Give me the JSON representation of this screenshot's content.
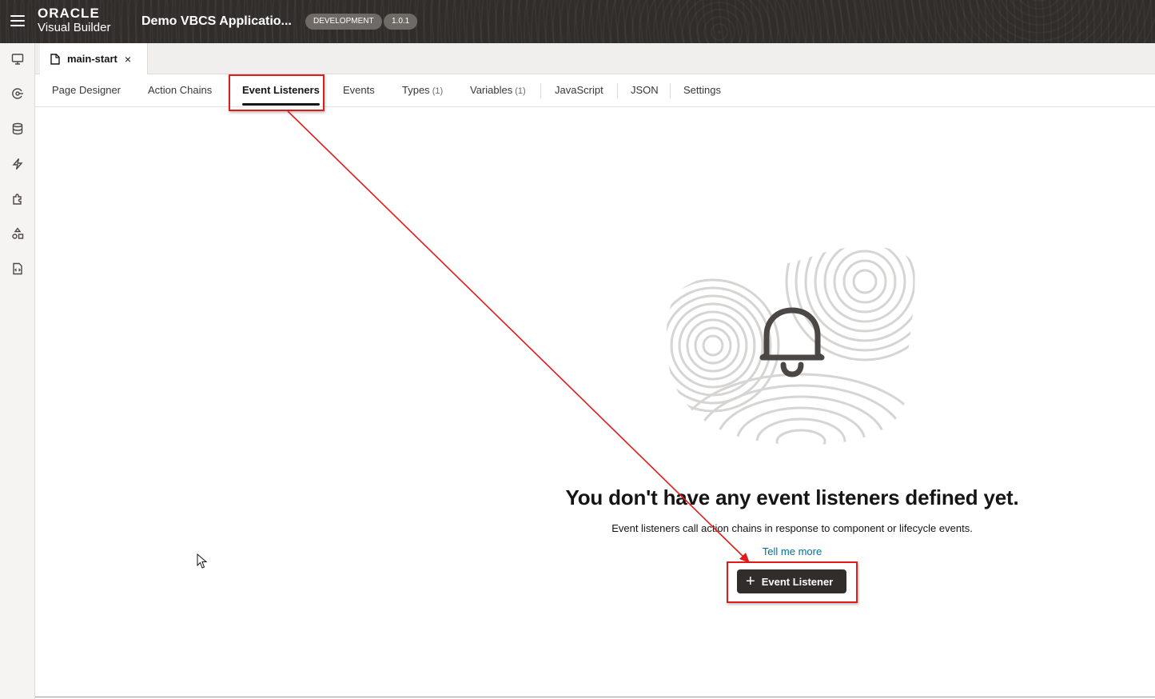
{
  "header": {
    "brand_top": "ORACLE",
    "brand_bottom": "Visual Builder",
    "app_title": "Demo VBCS Applicatio...",
    "env_badge": "DEVELOPMENT",
    "version_badge": "1.0.1"
  },
  "rail": {
    "items": [
      {
        "icon": "monitor-icon"
      },
      {
        "icon": "services-icon"
      },
      {
        "icon": "database-icon"
      },
      {
        "icon": "lightning-icon"
      },
      {
        "icon": "puzzle-icon"
      },
      {
        "icon": "components-icon"
      },
      {
        "icon": "source-file-icon"
      }
    ]
  },
  "file_tab": {
    "label": "main-start",
    "close": "×"
  },
  "subtabs": [
    {
      "label": "Page Designer",
      "count": ""
    },
    {
      "label": "Action Chains",
      "count": ""
    },
    {
      "label": "Event Listeners",
      "count": "",
      "active": true
    },
    {
      "label": "Events",
      "count": ""
    },
    {
      "label": "Types",
      "count": "(1)"
    },
    {
      "label": "Variables",
      "count": "(1)"
    },
    {
      "label": "JavaScript",
      "count": ""
    },
    {
      "label": "JSON",
      "count": ""
    },
    {
      "label": "Settings",
      "count": ""
    }
  ],
  "empty_state": {
    "title": "You don't have any event listeners defined yet.",
    "description": "Event listeners call action chains in response to component or lifecycle events.",
    "link": "Tell me more",
    "button_plus": "+",
    "button_label": "Event Listener",
    "illustration_icon": "bell-icon"
  },
  "colors": {
    "header_bg": "#312d2a",
    "annotation_red": "#e01b1b",
    "link_blue": "#036e9b"
  }
}
